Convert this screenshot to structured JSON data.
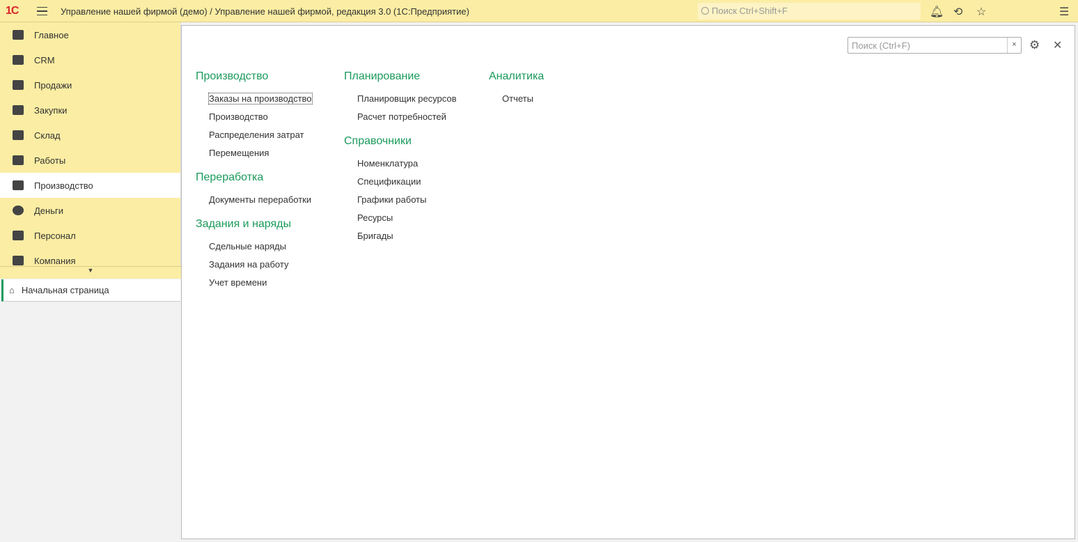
{
  "header": {
    "logo": "1С",
    "title": "Управление нашей фирмой (демо) / Управление нашей фирмой, редакция 3.0  (1С:Предприятие)",
    "search_placeholder": "Поиск Ctrl+Shift+F"
  },
  "sidebar": {
    "items": [
      {
        "label": "Главное"
      },
      {
        "label": "CRM"
      },
      {
        "label": "Продажи"
      },
      {
        "label": "Закупки"
      },
      {
        "label": "Склад"
      },
      {
        "label": "Работы"
      },
      {
        "label": "Производство",
        "active": true
      },
      {
        "label": "Деньги"
      },
      {
        "label": "Персонал"
      },
      {
        "label": "Компания"
      }
    ],
    "home": "Начальная страница"
  },
  "main": {
    "search_placeholder": "Поиск (Ctrl+F)",
    "clear": "×",
    "groups": [
      {
        "title": "Производство",
        "links": [
          "Заказы на производство",
          "Производство",
          "Распределения затрат",
          "Перемещения"
        ]
      },
      {
        "title": "Переработка",
        "links": [
          "Документы переработки"
        ]
      },
      {
        "title": "Задания и наряды",
        "links": [
          "Сдельные наряды",
          "Задания на работу",
          "Учет времени"
        ]
      },
      {
        "title": "Планирование",
        "links": [
          "Планировщик ресурсов",
          "Расчет потребностей"
        ]
      },
      {
        "title": "Справочники",
        "links": [
          "Номенклатура",
          "Спецификации",
          "Графики работы",
          "Ресурсы",
          "Бригады"
        ]
      },
      {
        "title": "Аналитика",
        "links": [
          "Отчеты"
        ]
      }
    ]
  },
  "colors": {
    "accent": "#1b9a5c",
    "panel": "#fbeda3"
  }
}
